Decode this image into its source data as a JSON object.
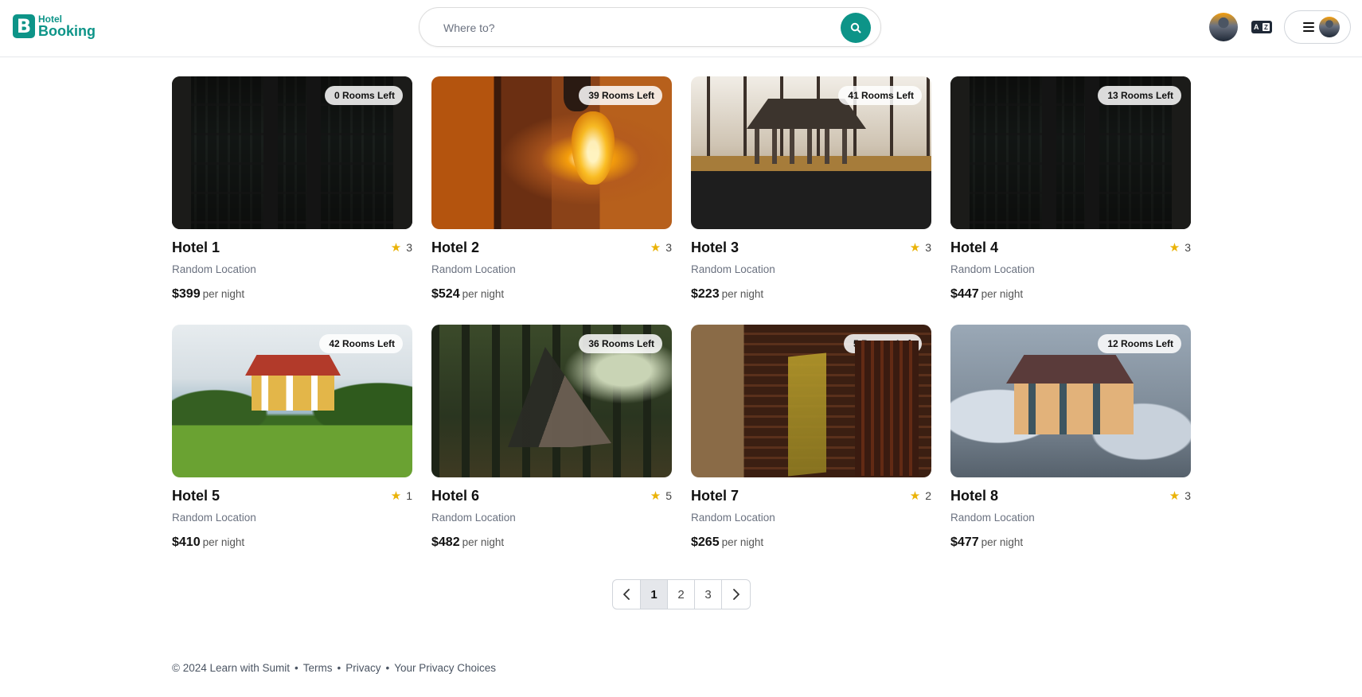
{
  "header": {
    "logo_top": "Hotel",
    "logo_bottom": "Booking",
    "logo_mark": "B",
    "search_placeholder": "Where to?",
    "search_icon": "search-icon",
    "language_icon": "language-icon"
  },
  "cards": [
    {
      "name": "Hotel 1",
      "rating": "3",
      "location": "Random Location",
      "price": "$399",
      "per": "per night",
      "rooms_left": "0 Rooms Left"
    },
    {
      "name": "Hotel 2",
      "rating": "3",
      "location": "Random Location",
      "price": "$524",
      "per": "per night",
      "rooms_left": "39 Rooms Left"
    },
    {
      "name": "Hotel 3",
      "rating": "3",
      "location": "Random Location",
      "price": "$223",
      "per": "per night",
      "rooms_left": "41 Rooms Left"
    },
    {
      "name": "Hotel 4",
      "rating": "3",
      "location": "Random Location",
      "price": "$447",
      "per": "per night",
      "rooms_left": "13 Rooms Left"
    },
    {
      "name": "Hotel 5",
      "rating": "1",
      "location": "Random Location",
      "price": "$410",
      "per": "per night",
      "rooms_left": "42 Rooms Left"
    },
    {
      "name": "Hotel 6",
      "rating": "5",
      "location": "Random Location",
      "price": "$482",
      "per": "per night",
      "rooms_left": "36 Rooms Left"
    },
    {
      "name": "Hotel 7",
      "rating": "2",
      "location": "Random Location",
      "price": "$265",
      "per": "per night",
      "rooms_left": "5 Rooms Left"
    },
    {
      "name": "Hotel 8",
      "rating": "3",
      "location": "Random Location",
      "price": "$477",
      "per": "per night",
      "rooms_left": "12 Rooms Left"
    }
  ],
  "pagination": {
    "pages": [
      "1",
      "2",
      "3"
    ],
    "current": "1"
  },
  "footer": {
    "copyright": "© 2024 Learn with Sumit",
    "terms": "Terms",
    "privacy": "Privacy",
    "choices": "Your Privacy Choices",
    "separator": "•"
  },
  "colors": {
    "brand": "#0d9488",
    "star": "#eab308"
  }
}
